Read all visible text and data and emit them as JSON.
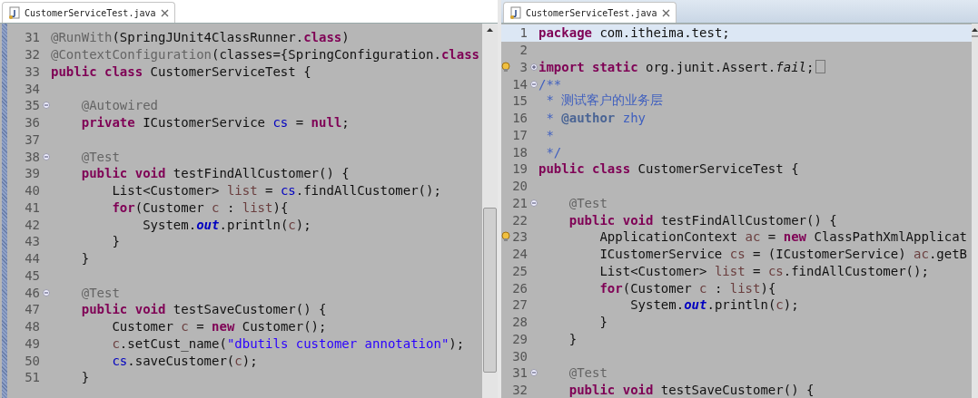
{
  "panes": [
    {
      "tab": {
        "title": "CustomerServiceTest.java"
      },
      "lines": [
        {
          "number": "31",
          "tokens": [
            {
              "kind": "ann",
              "t": "@RunWith"
            },
            {
              "kind": "plain",
              "t": "(SpringJUnit4ClassRunner."
            },
            {
              "kind": "kw",
              "t": "class"
            },
            {
              "kind": "plain",
              "t": ")"
            }
          ]
        },
        {
          "number": "32",
          "tokens": [
            {
              "kind": "ann",
              "t": "@ContextConfiguration"
            },
            {
              "kind": "plain",
              "t": "(classes={SpringConfiguration."
            },
            {
              "kind": "kw",
              "t": "class"
            }
          ]
        },
        {
          "number": "33",
          "tokens": [
            {
              "kind": "kw",
              "t": "public class"
            },
            {
              "kind": "plain",
              "t": " CustomerServiceTest {"
            }
          ]
        },
        {
          "number": "34"
        },
        {
          "number": "35",
          "expanded": true,
          "tokens": [
            {
              "kind": "ann",
              "t": "    @Autowired"
            }
          ]
        },
        {
          "number": "36",
          "tokens": [
            {
              "kind": "kw",
              "t": "    private"
            },
            {
              "kind": "plain",
              "t": " ICustomerService "
            },
            {
              "kind": "field",
              "t": "cs"
            },
            {
              "kind": "plain",
              "t": " = "
            },
            {
              "kind": "kw",
              "t": "null"
            },
            {
              "kind": "plain",
              "t": ";"
            }
          ]
        },
        {
          "number": "37"
        },
        {
          "number": "38",
          "expanded": true,
          "tokens": [
            {
              "kind": "ann",
              "t": "    @Test"
            }
          ]
        },
        {
          "number": "39",
          "tokens": [
            {
              "kind": "kw",
              "t": "    public void"
            },
            {
              "kind": "plain",
              "t": " testFindAllCustomer() {"
            }
          ]
        },
        {
          "number": "40",
          "tokens": [
            {
              "kind": "plain",
              "t": "        List<Customer> "
            },
            {
              "kind": "local",
              "t": "list"
            },
            {
              "kind": "plain",
              "t": " = "
            },
            {
              "kind": "field",
              "t": "cs"
            },
            {
              "kind": "plain",
              "t": ".findAllCustomer();"
            }
          ]
        },
        {
          "number": "41",
          "tokens": [
            {
              "kind": "kw",
              "t": "        for"
            },
            {
              "kind": "plain",
              "t": "(Customer "
            },
            {
              "kind": "local",
              "t": "c"
            },
            {
              "kind": "plain",
              "t": " : "
            },
            {
              "kind": "local",
              "t": "list"
            },
            {
              "kind": "plain",
              "t": "){"
            }
          ]
        },
        {
          "number": "42",
          "tokens": [
            {
              "kind": "plain",
              "t": "            System."
            },
            {
              "kind": "static",
              "t": "out"
            },
            {
              "kind": "plain",
              "t": ".println("
            },
            {
              "kind": "local",
              "t": "c"
            },
            {
              "kind": "plain",
              "t": ");"
            }
          ]
        },
        {
          "number": "43",
          "tokens": [
            {
              "kind": "plain",
              "t": "        }"
            }
          ]
        },
        {
          "number": "44",
          "tokens": [
            {
              "kind": "plain",
              "t": "    }"
            }
          ]
        },
        {
          "number": "45"
        },
        {
          "number": "46",
          "expanded": true,
          "tokens": [
            {
              "kind": "ann",
              "t": "    @Test"
            }
          ]
        },
        {
          "number": "47",
          "tokens": [
            {
              "kind": "kw",
              "t": "    public void"
            },
            {
              "kind": "plain",
              "t": " testSaveCustomer() {"
            }
          ]
        },
        {
          "number": "48",
          "tokens": [
            {
              "kind": "plain",
              "t": "        Customer "
            },
            {
              "kind": "local",
              "t": "c"
            },
            {
              "kind": "plain",
              "t": " = "
            },
            {
              "kind": "kw",
              "t": "new"
            },
            {
              "kind": "plain",
              "t": " Customer();"
            }
          ]
        },
        {
          "number": "49",
          "tokens": [
            {
              "kind": "local",
              "t": "        c"
            },
            {
              "kind": "plain",
              "t": ".setCust_name("
            },
            {
              "kind": "str",
              "t": "\"dbutils customer annotation\""
            },
            {
              "kind": "plain",
              "t": ");"
            }
          ]
        },
        {
          "number": "50",
          "tokens": [
            {
              "kind": "field",
              "t": "        cs"
            },
            {
              "kind": "plain",
              "t": ".saveCustomer("
            },
            {
              "kind": "local",
              "t": "c"
            },
            {
              "kind": "plain",
              "t": ");"
            }
          ]
        },
        {
          "number": "51",
          "tokens": [
            {
              "kind": "plain",
              "t": "    }"
            }
          ]
        }
      ]
    },
    {
      "tab": {
        "title": "CustomerServiceTest.java"
      },
      "lines": [
        {
          "number": "1",
          "current": true,
          "tokens": [
            {
              "kind": "kw",
              "t": "package"
            },
            {
              "kind": "plain",
              "t": " com.itheima.test;"
            }
          ]
        },
        {
          "number": "2"
        },
        {
          "number": "3",
          "expanded": false,
          "warning": true,
          "tokens": [
            {
              "kind": "kw",
              "t": "import static"
            },
            {
              "kind": "plain",
              "t": " org.junit.Assert."
            },
            {
              "kind": "italic",
              "t": "fail"
            },
            {
              "kind": "plain",
              "t": ";"
            }
          ]
        },
        {
          "number": "14",
          "expanded": true,
          "tokens": [
            {
              "kind": "doc",
              "t": "/**"
            }
          ]
        },
        {
          "number": "15",
          "tokens": [
            {
              "kind": "doc",
              "t": " * 测试客户的业务层"
            }
          ]
        },
        {
          "number": "16",
          "tokens": [
            {
              "kind": "doc",
              "t": " * "
            },
            {
              "kind": "doctag",
              "t": "@author"
            },
            {
              "kind": "doc",
              "t": " zhy"
            }
          ]
        },
        {
          "number": "17",
          "tokens": [
            {
              "kind": "doc",
              "t": " *"
            }
          ]
        },
        {
          "number": "18",
          "tokens": [
            {
              "kind": "doc",
              "t": " */"
            }
          ]
        },
        {
          "number": "19",
          "tokens": [
            {
              "kind": "kw",
              "t": "public class"
            },
            {
              "kind": "plain",
              "t": " CustomerServiceTest {"
            }
          ]
        },
        {
          "number": "20"
        },
        {
          "number": "21",
          "expanded": true,
          "tokens": [
            {
              "kind": "ann",
              "t": "    @Test"
            }
          ]
        },
        {
          "number": "22",
          "tokens": [
            {
              "kind": "kw",
              "t": "    public void"
            },
            {
              "kind": "plain",
              "t": " testFindAllCustomer() {"
            }
          ]
        },
        {
          "number": "23",
          "warning": true,
          "tokens": [
            {
              "kind": "plain",
              "t": "        ApplicationContext "
            },
            {
              "kind": "local",
              "t": "ac"
            },
            {
              "kind": "plain",
              "t": " = "
            },
            {
              "kind": "kw",
              "t": "new"
            },
            {
              "kind": "plain",
              "t": " ClassPathXmlApplicat"
            }
          ]
        },
        {
          "number": "24",
          "tokens": [
            {
              "kind": "plain",
              "t": "        ICustomerService "
            },
            {
              "kind": "local",
              "t": "cs"
            },
            {
              "kind": "plain",
              "t": " = (ICustomerService) "
            },
            {
              "kind": "local",
              "t": "ac"
            },
            {
              "kind": "plain",
              "t": ".getB"
            }
          ]
        },
        {
          "number": "25",
          "tokens": [
            {
              "kind": "plain",
              "t": "        List<Customer> "
            },
            {
              "kind": "local",
              "t": "list"
            },
            {
              "kind": "plain",
              "t": " = "
            },
            {
              "kind": "local",
              "t": "cs"
            },
            {
              "kind": "plain",
              "t": ".findAllCustomer();"
            }
          ]
        },
        {
          "number": "26",
          "tokens": [
            {
              "kind": "kw",
              "t": "        for"
            },
            {
              "kind": "plain",
              "t": "(Customer "
            },
            {
              "kind": "local",
              "t": "c"
            },
            {
              "kind": "plain",
              "t": " : "
            },
            {
              "kind": "local",
              "t": "list"
            },
            {
              "kind": "plain",
              "t": "){"
            }
          ]
        },
        {
          "number": "27",
          "tokens": [
            {
              "kind": "plain",
              "t": "            System."
            },
            {
              "kind": "static",
              "t": "out"
            },
            {
              "kind": "plain",
              "t": ".println("
            },
            {
              "kind": "local",
              "t": "c"
            },
            {
              "kind": "plain",
              "t": ");"
            }
          ]
        },
        {
          "number": "28",
          "tokens": [
            {
              "kind": "plain",
              "t": "        }"
            }
          ]
        },
        {
          "number": "29",
          "tokens": [
            {
              "kind": "plain",
              "t": "    }"
            }
          ]
        },
        {
          "number": "30"
        },
        {
          "number": "31",
          "expanded": true,
          "tokens": [
            {
              "kind": "ann",
              "t": "    @Test"
            }
          ]
        },
        {
          "number": "32",
          "tokens": [
            {
              "kind": "kw",
              "t": "    public void"
            },
            {
              "kind": "plain",
              "t": " testSaveCustomer() {"
            }
          ]
        }
      ]
    }
  ]
}
